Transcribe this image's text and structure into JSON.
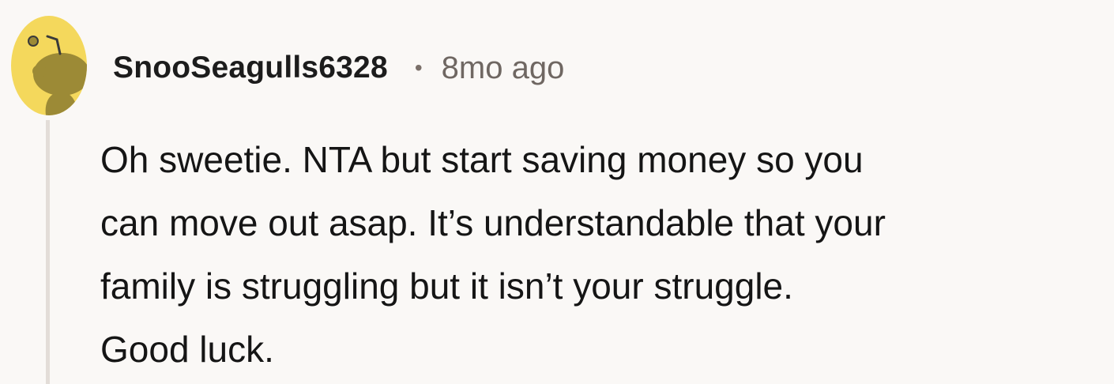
{
  "comment": {
    "author": "SnooSeagulls6328",
    "separator": "•",
    "timestamp": "8mo ago",
    "avatar_icon": "snoo-avatar-icon",
    "avatar_color": "#f4d85c",
    "body_lines": [
      "Oh sweetie. NTA but start saving money so you",
      "can move out asap. It’s understandable that your",
      "family is struggling but it isn’t your struggle.",
      "Good luck."
    ]
  }
}
